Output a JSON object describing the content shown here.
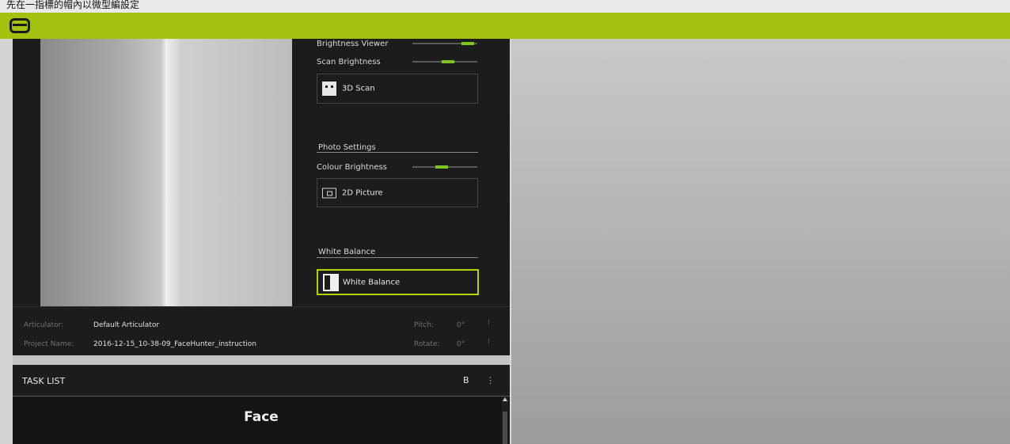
{
  "caption": "先在一指標的帽內以微型編設定",
  "scan": {
    "brightness_viewer_label": "Brightness Viewer",
    "brightness_viewer_level": 0.85,
    "scan_brightness_label": "Scan Brightness",
    "scan_brightness_level": 0.55,
    "scan_button_label": "3D Scan"
  },
  "photo": {
    "section_title": "Photo Settings",
    "colour_brightness_label": "Colour Brightness",
    "colour_brightness_level": 0.45,
    "picture_button_label": "2D Picture"
  },
  "white_balance": {
    "section_title": "White Balance",
    "button_label": "White Balance"
  },
  "info": {
    "articulator_key": "Articulator:",
    "articulator_value": "Default Articulator",
    "project_key": "Project Name:",
    "project_value": "2016-12-15_10-38-09_FaceHunter_instruction",
    "pitch_key": "Pitch:",
    "pitch_value": "0°",
    "rotate_key": "Rotate:",
    "rotate_value": "0°"
  },
  "task_list": {
    "title": "TASK LIST",
    "icon_label": "B",
    "more_label": "⋮",
    "current_task": "Face"
  },
  "icons": {
    "menu": "menu-icon",
    "scan": "face-scan-icon",
    "picture": "picture-icon",
    "white_balance": "white-balance-icon"
  },
  "colors": {
    "accent": "#a1c20e",
    "slider_active": "#7fc421",
    "panel_bg": "#1c1c1c",
    "selected_border": "#b5d20f"
  }
}
